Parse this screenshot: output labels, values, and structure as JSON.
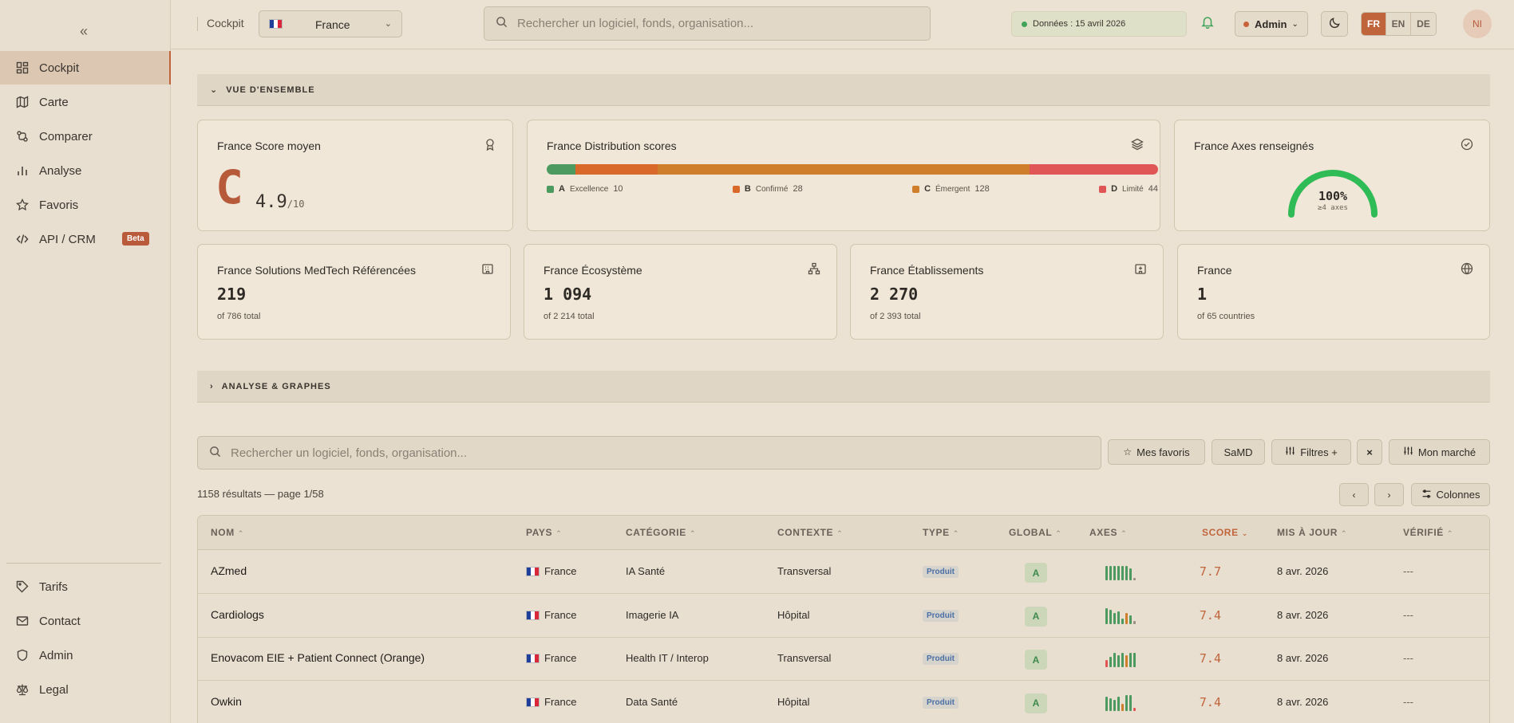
{
  "sidebar": {
    "collapse": "«",
    "items": [
      {
        "label": "Cockpit",
        "icon": "grid-icon",
        "active": true
      },
      {
        "label": "Carte",
        "icon": "map-icon"
      },
      {
        "label": "Comparer",
        "icon": "compare-icon"
      },
      {
        "label": "Analyse",
        "icon": "bar-chart-icon"
      },
      {
        "label": "Favoris",
        "icon": "star-icon"
      },
      {
        "label": "API / CRM",
        "icon": "code-icon",
        "badge": "Beta"
      }
    ],
    "bottom_items": [
      {
        "label": "Tarifs",
        "icon": "tag-icon"
      },
      {
        "label": "Contact",
        "icon": "mail-icon"
      },
      {
        "label": "Admin",
        "icon": "shield-icon"
      },
      {
        "label": "Legal",
        "icon": "scale-icon"
      }
    ]
  },
  "topbar": {
    "breadcrumb": "Cockpit",
    "country": "France",
    "search_placeholder": "Rechercher un logiciel, fonds, organisation...",
    "data_date": "Données : 15 avril 2026",
    "admin_label": "Admin",
    "languages": [
      "FR",
      "EN",
      "DE"
    ],
    "active_language": "FR",
    "avatar_initials": "NI"
  },
  "overview": {
    "section_title": "VUE D'ENSEMBLE",
    "score_card": {
      "title": "France Score moyen",
      "grade": "C",
      "score": "4.9",
      "max": "/10"
    },
    "distribution": {
      "title": "France Distribution scores",
      "segments": [
        {
          "letter": "A",
          "name": "Excellence",
          "count": 10,
          "color": "#4c9a5f"
        },
        {
          "letter": "B",
          "name": "Confirmé",
          "count": 28,
          "color": "#d9692a"
        },
        {
          "letter": "C",
          "name": "Émergent",
          "count": 128,
          "color": "#cf7e2c"
        },
        {
          "letter": "D",
          "name": "Limité",
          "count": 44,
          "color": "#e05555"
        }
      ]
    },
    "axes_card": {
      "title": "France Axes renseignés",
      "value": "100%",
      "sub": "≥4 axes",
      "fraction": 1.0
    }
  },
  "stats": [
    {
      "title": "France Solutions MedTech Référencées",
      "value": "219",
      "sub": "of 786 total",
      "icon": "building-icon"
    },
    {
      "title": "France Écosystème",
      "value": "1 094",
      "sub": "of 2 214 total",
      "icon": "network-icon"
    },
    {
      "title": "France Établissements",
      "value": "2 270",
      "sub": "of 2 393 total",
      "icon": "hospital-icon"
    },
    {
      "title": "France",
      "value": "1",
      "sub": "of 65 countries",
      "icon": "globe-icon"
    }
  ],
  "analysis": {
    "section_title": "ANALYSE & GRAPHES"
  },
  "toolbar": {
    "search_placeholder": "Rechercher un logiciel, fonds, organisation...",
    "favorites": "Mes favoris",
    "samd": "SaMD",
    "filters": "Filtres +",
    "clear": "×",
    "market": "Mon marché",
    "results": "1158 résultats — page 1/58",
    "columns": "Colonnes"
  },
  "table": {
    "headers": [
      "NOM",
      "PAYS",
      "CATÉGORIE",
      "CONTEXTE",
      "TYPE",
      "GLOBAL",
      "AXES",
      "SCORE",
      "MIS À JOUR",
      "VÉRIFIÉ"
    ],
    "rows": [
      {
        "name": "AZmed",
        "country": "France",
        "category": "IA Santé",
        "context": "Transversal",
        "type": "Produit",
        "global": "A",
        "score": "7.7",
        "updated": "8 avr. 2026",
        "verified": "---",
        "axes": [
          {
            "h": 0.8,
            "c": "#4c9a5f"
          },
          {
            "h": 0.8,
            "c": "#4c9a5f"
          },
          {
            "h": 0.8,
            "c": "#4c9a5f"
          },
          {
            "h": 0.8,
            "c": "#4c9a5f"
          },
          {
            "h": 0.8,
            "c": "#4c9a5f"
          },
          {
            "h": 0.8,
            "c": "#4c9a5f"
          },
          {
            "h": 0.7,
            "c": "#4c9a5f"
          },
          {
            "h": 0.15,
            "c": "#9a9080"
          }
        ]
      },
      {
        "name": "Cardiologs",
        "country": "France",
        "category": "Imagerie IA",
        "context": "Hôpital",
        "type": "Produit",
        "global": "A",
        "score": "7.4",
        "updated": "8 avr. 2026",
        "verified": "---",
        "axes": [
          {
            "h": 0.9,
            "c": "#4c9a5f"
          },
          {
            "h": 0.8,
            "c": "#4c9a5f"
          },
          {
            "h": 0.6,
            "c": "#4c9a5f"
          },
          {
            "h": 0.7,
            "c": "#4c9a5f"
          },
          {
            "h": 0.3,
            "c": "#4c9a5f"
          },
          {
            "h": 0.6,
            "c": "#cf7e2c"
          },
          {
            "h": 0.5,
            "c": "#4c9a5f"
          },
          {
            "h": 0.15,
            "c": "#9a9080"
          }
        ]
      },
      {
        "name": "Enovacom EIE + Patient Connect (Orange)",
        "country": "France",
        "category": "Health IT / Interop",
        "context": "Transversal",
        "type": "Produit",
        "global": "A",
        "score": "7.4",
        "updated": "8 avr. 2026",
        "verified": "---",
        "axes": [
          {
            "h": 0.4,
            "c": "#e05555"
          },
          {
            "h": 0.6,
            "c": "#4c9a5f"
          },
          {
            "h": 0.8,
            "c": "#4c9a5f"
          },
          {
            "h": 0.7,
            "c": "#4c9a5f"
          },
          {
            "h": 0.8,
            "c": "#4c9a5f"
          },
          {
            "h": 0.7,
            "c": "#cf7e2c"
          },
          {
            "h": 0.8,
            "c": "#4c9a5f"
          },
          {
            "h": 0.8,
            "c": "#4c9a5f"
          }
        ]
      },
      {
        "name": "Owkin",
        "country": "France",
        "category": "Data Santé",
        "context": "Hôpital",
        "type": "Produit",
        "global": "A",
        "score": "7.4",
        "updated": "8 avr. 2026",
        "verified": "---",
        "axes": [
          {
            "h": 0.8,
            "c": "#4c9a5f"
          },
          {
            "h": 0.7,
            "c": "#4c9a5f"
          },
          {
            "h": 0.6,
            "c": "#4c9a5f"
          },
          {
            "h": 0.8,
            "c": "#4c9a5f"
          },
          {
            "h": 0.4,
            "c": "#cf7e2c"
          },
          {
            "h": 0.9,
            "c": "#4c9a5f"
          },
          {
            "h": 0.9,
            "c": "#4c9a5f"
          },
          {
            "h": 0.15,
            "c": "#e05555"
          }
        ]
      }
    ]
  }
}
